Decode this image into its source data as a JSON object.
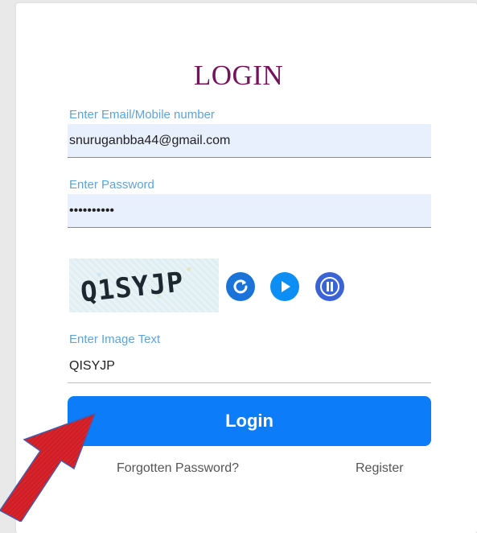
{
  "form": {
    "title": "LOGIN",
    "email_label": "Enter Email/Mobile number",
    "email_value": "snuruganbba44@gmail.com",
    "password_label": "Enter Password",
    "password_value": "**********",
    "captcha_text": "Q1SYJP",
    "captcha_icons": [
      "refresh-icon",
      "play-icon",
      "pause-icon"
    ],
    "image_text_label": "Enter Image Text",
    "image_text_value": "QISYJP",
    "login_button": "Login",
    "forgot_link": "Forgotten Password?",
    "register_link": "Register"
  },
  "colors": {
    "title": "#74125b",
    "label": "#5fa3da",
    "button": "#0d7cf8",
    "arrow": "#d8232a"
  }
}
